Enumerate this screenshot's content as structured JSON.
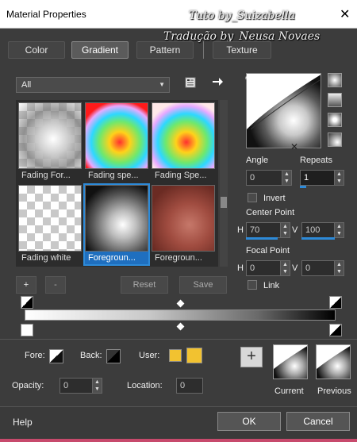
{
  "window": {
    "title": "Material Properties",
    "close_glyph": "✕"
  },
  "watermark": {
    "line1": "Tuto by_Suizabella",
    "line2": "Tradução by_Neusa Novaes"
  },
  "tabs": [
    {
      "label": "Color",
      "active": false
    },
    {
      "label": "Gradient",
      "active": true
    },
    {
      "label": "Pattern",
      "active": false
    },
    {
      "label": "Texture",
      "active": false
    }
  ],
  "category": {
    "selected": "All"
  },
  "gradients": [
    {
      "label": "Fading For...",
      "selected": false
    },
    {
      "label": "Fading spe...",
      "selected": false
    },
    {
      "label": "Fading Spe...",
      "selected": false
    },
    {
      "label": "Fading white",
      "selected": false
    },
    {
      "label": "Foregroun...",
      "selected": true
    },
    {
      "label": "Foregroun...",
      "selected": false
    }
  ],
  "library_buttons": {
    "add": "+",
    "remove": "-",
    "reset": "Reset",
    "save": "Save"
  },
  "angle": {
    "label": "Angle",
    "value": "0"
  },
  "repeats": {
    "label": "Repeats",
    "value": "1"
  },
  "invert": {
    "label": "Invert",
    "checked": false
  },
  "center_point": {
    "label": "Center Point",
    "h_label": "H",
    "h_value": "70",
    "v_label": "V",
    "v_value": "100"
  },
  "focal_point": {
    "label": "Focal Point",
    "h_label": "H",
    "h_value": "0",
    "v_label": "V",
    "v_value": "0"
  },
  "link": {
    "label": "Link",
    "checked": false
  },
  "fore": {
    "label": "Fore:"
  },
  "back": {
    "label": "Back:"
  },
  "user": {
    "label": "User:",
    "color": "#f2c230"
  },
  "opacity": {
    "label": "Opacity:",
    "value": "0"
  },
  "location": {
    "label": "Location:",
    "value": "0"
  },
  "current": {
    "label": "Current"
  },
  "previous": {
    "label": "Previous"
  },
  "footer": {
    "help": "Help",
    "ok": "OK",
    "cancel": "Cancel"
  },
  "colors": {
    "accent": "#2d8ad8",
    "bottom_bar": "#c74a6c"
  }
}
